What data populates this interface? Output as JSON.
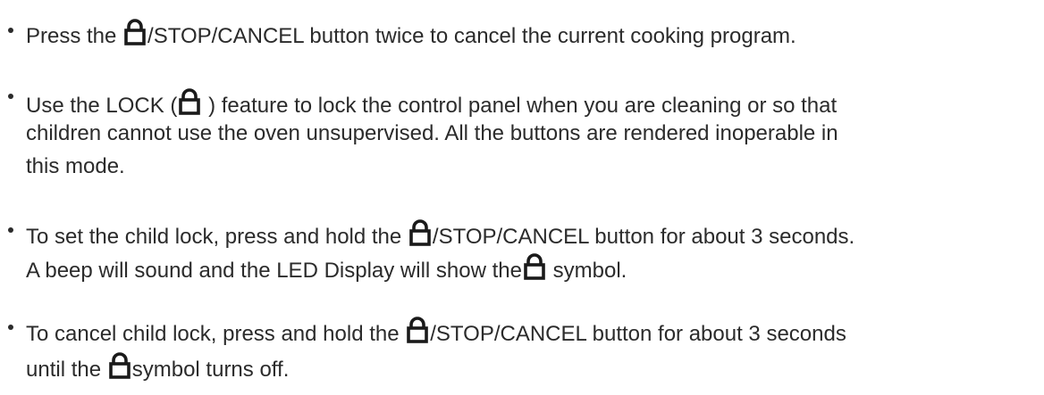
{
  "instructions": {
    "item1": {
      "line1": {
        "a": "Press the ",
        "b": "/STOP/CANCEL button twice to cancel the current cooking program."
      }
    },
    "item2": {
      "line1": {
        "a": "Use the LOCK (",
        "b": " ) feature to lock the control panel when you are cleaning or so that"
      },
      "line2": "children cannot use the oven unsupervised. All the buttons are rendered inoperable in",
      "line3": "this mode."
    },
    "item3": {
      "line1": {
        "a": "To set the child lock, press and hold the ",
        "b": "/STOP/CANCEL button for about 3 seconds."
      },
      "line2": {
        "a": "A beep will sound and the LED Display will show the",
        "b": " symbol."
      }
    },
    "item4": {
      "line1": {
        "a": "To cancel child lock, press and hold the ",
        "b": "/STOP/CANCEL button for about 3 seconds"
      },
      "line2": {
        "a": "until the ",
        "b": "symbol turns off."
      }
    }
  },
  "icons": {
    "lock": "lock-icon"
  },
  "colors": {
    "text": "#2b2b2b",
    "icon": "#1a1a1a"
  }
}
